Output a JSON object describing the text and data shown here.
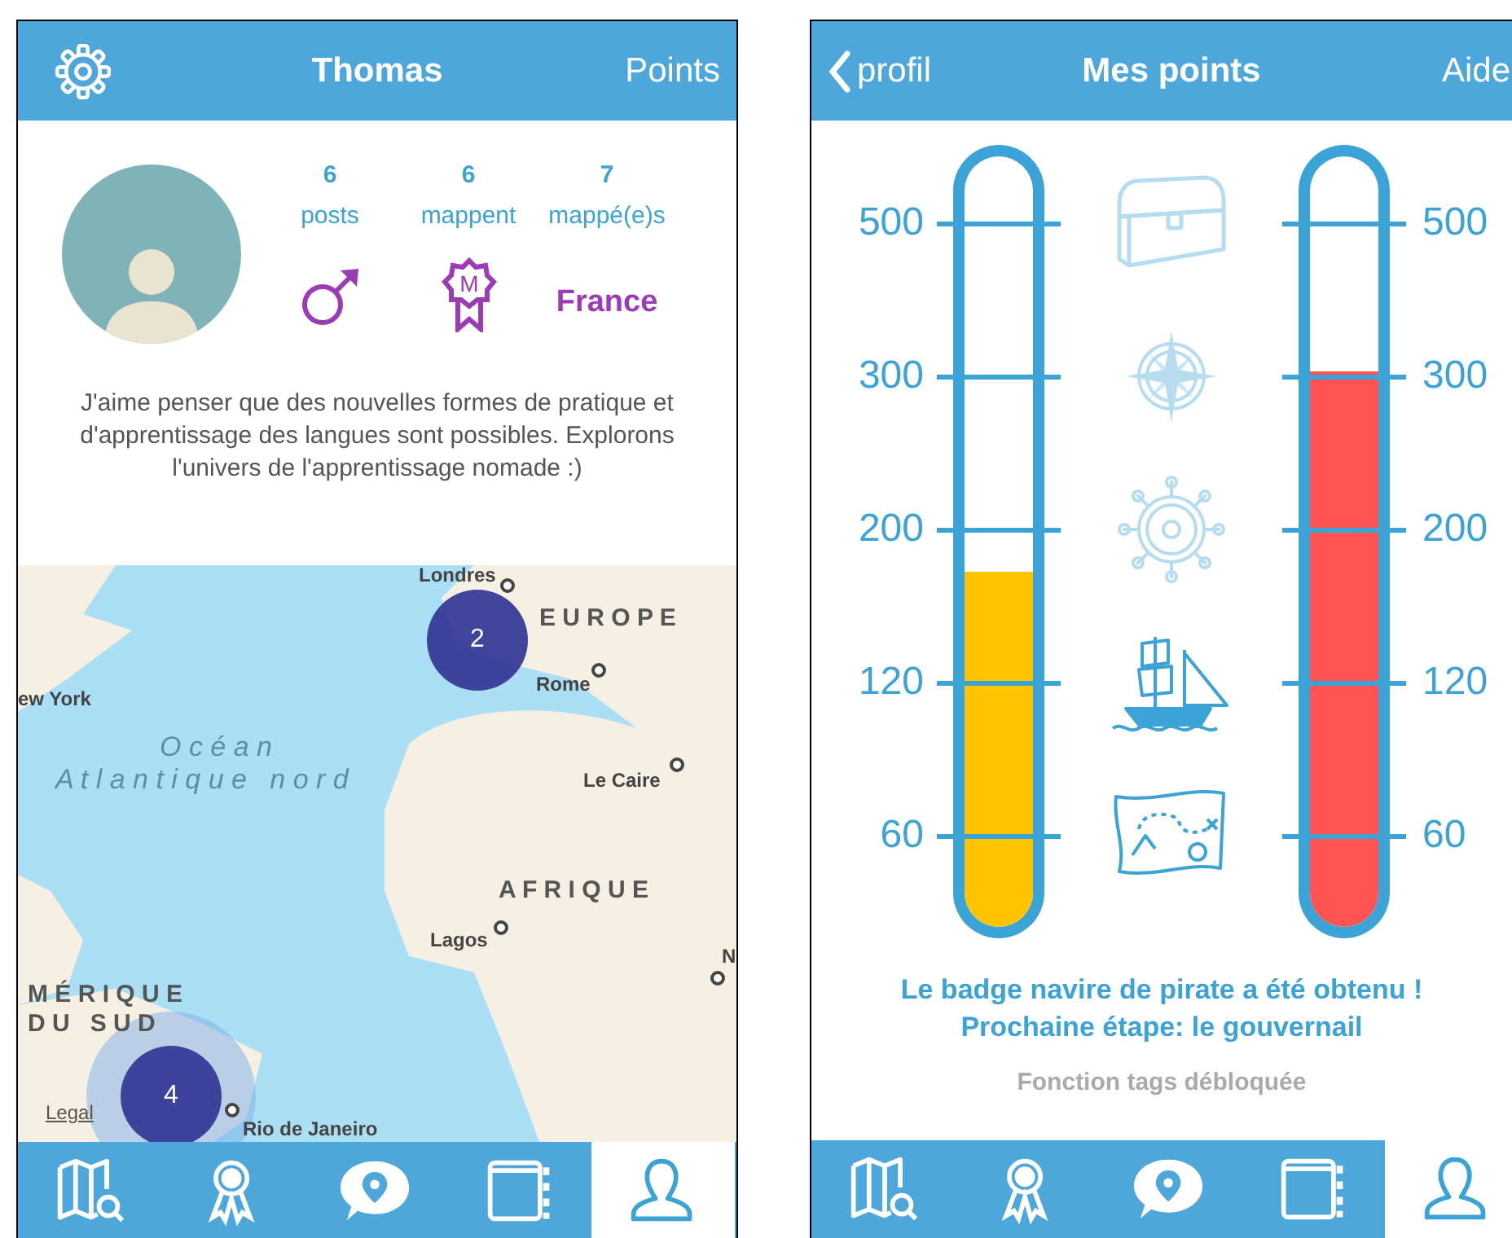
{
  "profile_screen": {
    "header": {
      "title": "Thomas",
      "right_action": "Points"
    },
    "stats": [
      {
        "value": "6",
        "label": "posts"
      },
      {
        "value": "6",
        "label": "mappent"
      },
      {
        "value": "7",
        "label": "mappé(e)s"
      }
    ],
    "badge_letter": "M",
    "country": "France",
    "bio": "J'aime penser que des nouvelles formes de pratique et d'apprentissage des langues sont possibles. Explorons l'univers de l'apprentissage nomade :)",
    "map": {
      "labels": [
        {
          "text": "Londres",
          "kind": "city"
        },
        {
          "text": "E U R O P E",
          "kind": "region"
        },
        {
          "text": "Rome",
          "kind": "city"
        },
        {
          "text": "ew York",
          "kind": "city"
        },
        {
          "text": "O c é a n",
          "kind": "ocean"
        },
        {
          "text": "A t l a n t i q u e   n o r d",
          "kind": "ocean"
        },
        {
          "text": "Le Caire",
          "kind": "city"
        },
        {
          "text": "A F R I Q U E",
          "kind": "region"
        },
        {
          "text": "Lagos",
          "kind": "city"
        },
        {
          "text": "N",
          "kind": "city"
        },
        {
          "text": "M É R I Q U E",
          "kind": "region"
        },
        {
          "text": "D U   S U D",
          "kind": "region"
        },
        {
          "text": "Rio de Janeiro",
          "kind": "city"
        }
      ],
      "clusters": [
        {
          "count": "2",
          "halo": false
        },
        {
          "count": "4",
          "halo": true
        }
      ],
      "legal_link": "Legal"
    },
    "tab_bar": [
      {
        "kind": "map",
        "selected": false
      },
      {
        "kind": "badge",
        "selected": false
      },
      {
        "kind": "chat",
        "selected": false
      },
      {
        "kind": "book",
        "selected": false
      },
      {
        "kind": "profile",
        "selected": true
      }
    ]
  },
  "points_screen": {
    "header": {
      "back": "profil",
      "title": "Mes points",
      "right_action": "Aide"
    },
    "gauges": [
      {
        "level": 0.46,
        "color": "#ffc400",
        "tick_labels": [
          "500",
          "300",
          "200",
          "120",
          "60"
        ]
      },
      {
        "level": 0.72,
        "color": "#ff5252",
        "tick_labels": [
          "500",
          "300",
          "200",
          "120",
          "60"
        ]
      }
    ],
    "milestones": [
      {
        "kind": "chest",
        "unlocked": false
      },
      {
        "kind": "compass",
        "unlocked": false
      },
      {
        "kind": "wheel",
        "unlocked": false
      },
      {
        "kind": "ship",
        "unlocked": true
      },
      {
        "kind": "map",
        "unlocked": true
      }
    ],
    "message": [
      "Le badge navire de pirate a été obtenu !",
      "Prochaine étape: le gouvernail"
    ],
    "unlock_note": "Fonction tags débloquée",
    "tab_bar": [
      {
        "kind": "map",
        "selected": false
      },
      {
        "kind": "badge",
        "selected": false
      },
      {
        "kind": "chat",
        "selected": false
      },
      {
        "kind": "book",
        "selected": false
      },
      {
        "kind": "profile",
        "selected": true
      }
    ]
  }
}
